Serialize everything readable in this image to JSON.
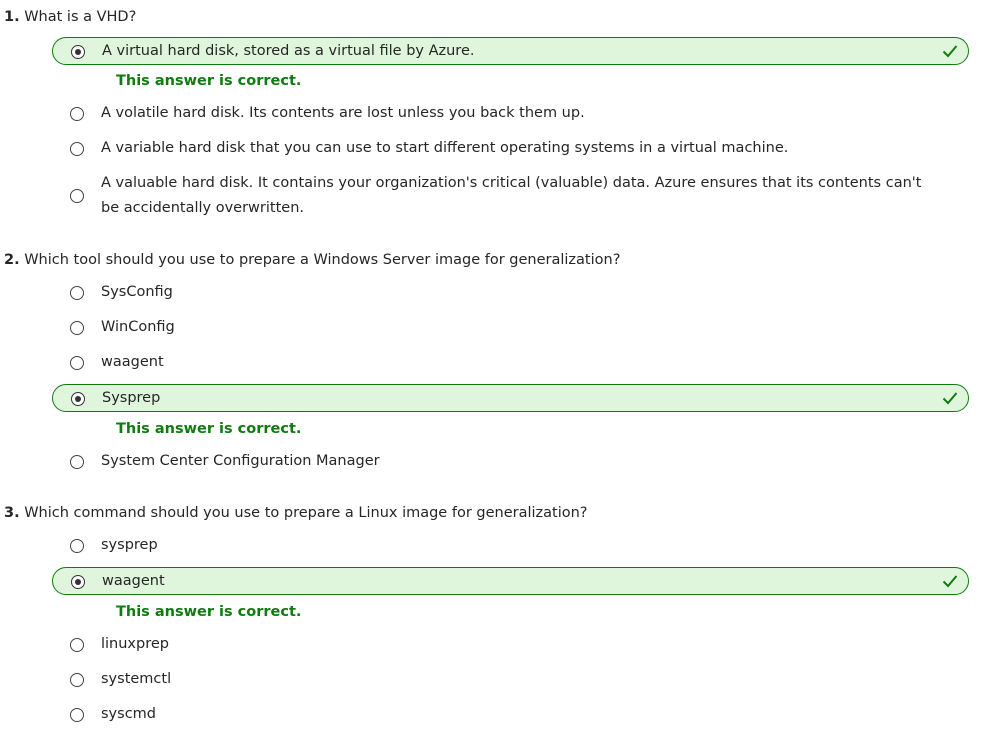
{
  "questions": [
    {
      "number": "1.",
      "text": "What is a VHD?",
      "options": [
        "A virtual hard disk, stored as a virtual file by Azure.",
        "A volatile hard disk. Its contents are lost unless you back them up.",
        "A variable hard disk that you can use to start different operating systems in a virtual machine.",
        "A valuable hard disk. It contains your organization's critical (valuable) data. Azure ensures that its contents can't be accidentally overwritten."
      ],
      "selected_index": 0
    },
    {
      "number": "2.",
      "text": "Which tool should you use to prepare a Windows Server image for generalization?",
      "options": [
        "SysConfig",
        "WinConfig",
        "waagent",
        "Sysprep",
        "System Center Configuration Manager"
      ],
      "selected_index": 3
    },
    {
      "number": "3.",
      "text": "Which command should you use to prepare a Linux image for generalization?",
      "options": [
        "sysprep",
        "waagent",
        "linuxprep",
        "systemctl",
        "syscmd"
      ],
      "selected_index": 1
    }
  ],
  "feedback": {
    "correct": "This answer is correct."
  },
  "icons": {
    "selected_check": "checkmark-icon"
  },
  "colors": {
    "correct_green": "#107c10",
    "correct_bg": "#dff6dd"
  }
}
